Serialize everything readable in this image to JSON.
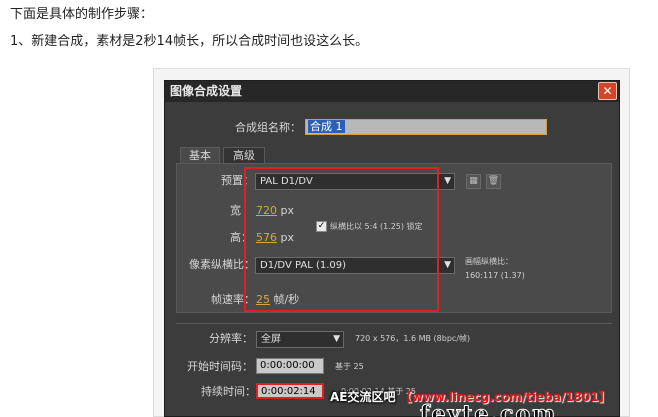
{
  "article": {
    "intro": "下面是具体的制作步骤：",
    "step1": "1、新建合成，素材是2秒14帧长，所以合成时间也设这么长。"
  },
  "dialog": {
    "title": "图像合成设置",
    "close_glyph": "✕",
    "name_label": "合成组名称：",
    "name_value": "合成 1",
    "tabs": [
      "基本",
      "高级"
    ],
    "preset_label": "预置：",
    "preset_value": "PAL D1/DV",
    "width_label": "宽",
    "width_value": "720",
    "width_unit": "px",
    "height_label": "高：",
    "height_value": "576",
    "height_unit": "px",
    "lock_label": "纵横比以 5:4 (1.25) 锁定",
    "pixel_aspect_label": "像素纵横比：",
    "pixel_aspect_value": "D1/DV PAL (1.09)",
    "frame_aspect_label": "画幅纵横比：",
    "frame_aspect_value": "160:117 (1.37)",
    "framerate_label": "帧速率：",
    "framerate_value": "25",
    "framerate_unit": "帧/秒",
    "resolution_label": "分辨率：",
    "resolution_value": "全屏",
    "resolution_info": "720 x 576，1.6 MB (8bpc/帧)",
    "start_tc_label": "开始时间码：",
    "start_tc_value": "0:00:00:00",
    "start_tc_info": "基于 25",
    "duration_label": "持续时间：",
    "duration_value": "0:00:02:14",
    "duration_info": "0:00:02:14 基于 25"
  },
  "watermark": {
    "text_prefix": "AE交流区吧",
    "url": "【www.linecg.com/tieba/1801】",
    "logo": "fevte.com"
  },
  "icons": {
    "dropdown": "▼",
    "checkmark": "✓",
    "save_preset": "▦",
    "delete_preset": "🗑"
  },
  "colors": {
    "highlight_box": "#e02020",
    "link_value": "#d7a640",
    "close_button": "#d2452a"
  }
}
